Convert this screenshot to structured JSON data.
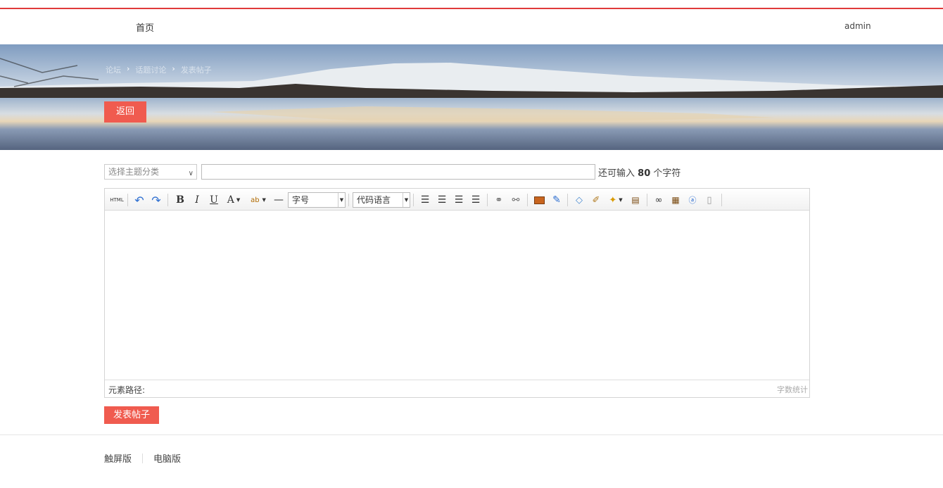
{
  "nav": {
    "home": "首页",
    "user": "admin"
  },
  "banner": {
    "crumbs": [
      "论坛",
      "话题讨论",
      "发表帖子"
    ],
    "back_label": "返回"
  },
  "form": {
    "category_placeholder": "选择主题分类",
    "title_value": "",
    "remain_prefix": "还可输入",
    "remain_count": "80",
    "remain_suffix": "个字符"
  },
  "editor": {
    "toolbar": {
      "html": "HTML",
      "font_size": "字号",
      "code_lang": "代码语言"
    },
    "path_label": "元素路径:",
    "word_count": "字数统计"
  },
  "submit_label": "发表帖子",
  "footer": {
    "touch": "触屏版",
    "pc": "电脑版"
  },
  "colors": {
    "accent": "#f05b4f",
    "topline": "#e03a3a"
  }
}
